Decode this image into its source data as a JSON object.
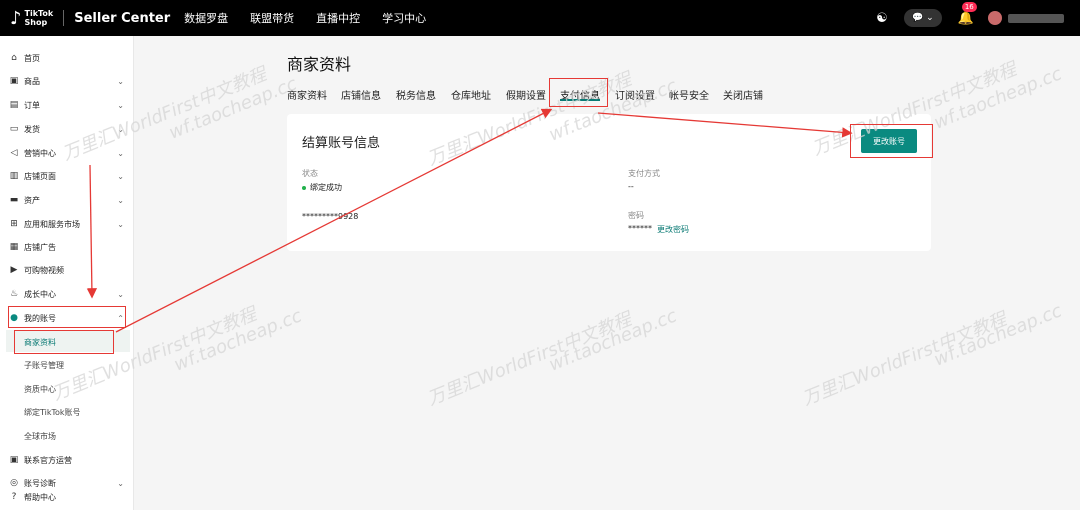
{
  "topbar": {
    "logo_line1": "TikTok",
    "logo_line2": "Shop",
    "title": "Seller Center",
    "nav": [
      "数据罗盘",
      "联盟带货",
      "直播中控",
      "学习中心"
    ],
    "notification_count": "16",
    "support_icon": "headset-icon",
    "chat_icon": "chat-icon",
    "bell_icon": "bell-icon"
  },
  "sidebar": {
    "items": [
      {
        "label": "首页",
        "icon": "home-icon",
        "has_chevron": false
      },
      {
        "label": "商品",
        "icon": "box-icon",
        "has_chevron": true
      },
      {
        "label": "订单",
        "icon": "order-icon",
        "has_chevron": true
      },
      {
        "label": "发货",
        "icon": "truck-icon",
        "has_chevron": true
      },
      {
        "label": "营销中心",
        "icon": "megaphone-icon",
        "has_chevron": true
      },
      {
        "label": "店铺页面",
        "icon": "store-icon",
        "has_chevron": true
      },
      {
        "label": "资产",
        "icon": "wallet-icon",
        "has_chevron": true
      },
      {
        "label": "应用和服务市场",
        "icon": "apps-icon",
        "has_chevron": true
      },
      {
        "label": "店铺广告",
        "icon": "ad-icon",
        "has_chevron": false
      },
      {
        "label": "可购物视频",
        "icon": "video-icon",
        "has_chevron": false
      },
      {
        "label": "成长中心",
        "icon": "growth-icon",
        "has_chevron": true
      },
      {
        "label": "我的账号",
        "icon": "user-icon",
        "has_chevron": true,
        "expanded": true
      }
    ],
    "subitems": [
      "商家资料",
      "子账号管理",
      "资质中心",
      "绑定TikTok账号",
      "全球市场"
    ],
    "bottom_items": [
      {
        "label": "联系官方运营",
        "icon": "contact-icon",
        "has_chevron": false
      },
      {
        "label": "账号诊断",
        "icon": "diagnose-icon",
        "has_chevron": true
      },
      {
        "label": "帮助中心",
        "icon": "help-icon",
        "has_chevron": false
      }
    ]
  },
  "main": {
    "title": "商家资料",
    "tabs": [
      "商家资料",
      "店铺信息",
      "税务信息",
      "仓库地址",
      "假期设置",
      "支付信息",
      "订阅设置",
      "帐号安全",
      "关闭店铺"
    ],
    "active_tab": "支付信息"
  },
  "card": {
    "title": "结算账号信息",
    "button": "更改账号",
    "status_label": "状态",
    "status_value": "绑定成功",
    "status_color": "#22b14c",
    "account_value": "*********9928",
    "payment_method_label": "支付方式",
    "payment_method_value": "--",
    "password_label": "密码",
    "password_value": "******",
    "password_link": "更改密码"
  },
  "watermark": [
    "万里汇WorldFirst中文教程",
    "wf.taocheap.cc"
  ],
  "colors": {
    "accent": "#0a8a80",
    "annotation": "#e53935",
    "topbar": "#000000"
  }
}
